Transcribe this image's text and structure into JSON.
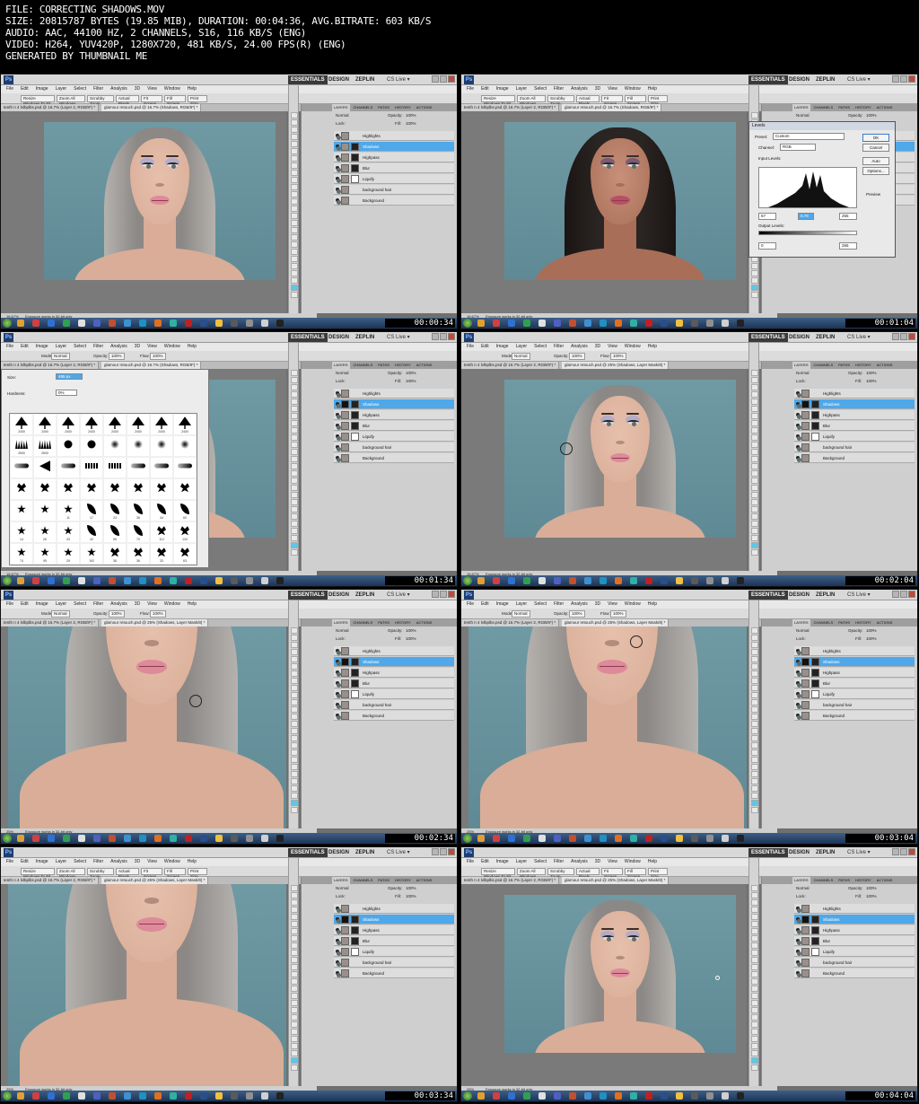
{
  "header": {
    "lines": [
      "FILE: CORRECTING SHADOWS.MOV",
      "SIZE: 20815787 BYTES (19.85 MIB), DURATION: 00:04:36, AVG.BITRATE: 603 KB/S",
      "AUDIO: AAC, 44100 HZ, 2 CHANNELS, S16, 116 KB/S (ENG)",
      "VIDEO: H264, YUV420P, 1280X720, 481 KB/S, 24.00 FPS(R) (ENG)",
      "GENERATED BY THUMBNAIL ME"
    ]
  },
  "ps": {
    "logo": "Ps",
    "workspaces": [
      "ESSENTIALS",
      "DESIGN",
      "ZEPLIN"
    ],
    "cs_live": "CS Live ▾",
    "menus": [
      "File",
      "Edit",
      "Image",
      "Layer",
      "Select",
      "Filter",
      "Analysis",
      "3D",
      "View",
      "Window",
      "Help"
    ],
    "zoom_options": [
      "Resize Windows To Fit",
      "Zoom All Windows",
      "Scrubby Zoom",
      "Actual Pixels",
      "Fit Screen",
      "Fill Screen",
      "Print Size"
    ],
    "brush_options": {
      "mode_label": "Mode:",
      "mode": "Normal",
      "opacity_label": "Opacity:",
      "opacity": "100%",
      "flow_label": "Flow:",
      "flow": "100%"
    },
    "doc_tabs": [
      "tenth n 4 lvlbplbs.psd @ 16.7% (Layer 2, RGB/8*) *",
      "glamour retouch.psd @ 16.7% (Shadows, RGB/8*) *"
    ],
    "doc_tabs_b": [
      "tenth n 4 lvlbplbs.psd @ 16.7% (Layer 2, RGB/8*) *",
      "glamour retouch.psd @ 25% (Shadows, Layer Mask/8) *"
    ],
    "panel_tabs": [
      "LAYERS",
      "CHANNELS",
      "PATHS",
      "HISTORY",
      "ACTIONS"
    ],
    "blend_mode": "Normal",
    "opacity_label": "Opacity:",
    "opacity": "100%",
    "lock_label": "Lock:",
    "fill_label": "Fill:",
    "fill": "100%",
    "layers": [
      "Highlights",
      "Shadows",
      "Highpass",
      "Blur",
      "Liquify",
      "background hair",
      "Background"
    ],
    "status": "Exposure works in 32-bit only",
    "zoom_a": "16.67%",
    "zoom_b": "25%"
  },
  "levels": {
    "title": "Levels",
    "preset_label": "Preset:",
    "preset": "Custom",
    "channel_label": "Channel:",
    "channel": "RGB",
    "input_label": "Input Levels:",
    "input_values": [
      "67",
      "0.78",
      "255"
    ],
    "output_label": "Output Levels:",
    "output_values": [
      "0",
      "255"
    ],
    "buttons": [
      "OK",
      "Cancel",
      "Auto",
      "Options..."
    ],
    "preview": "Preview"
  },
  "brush_picker": {
    "size_label": "Size:",
    "size": "485 px",
    "hardness_label": "Hardness:",
    "hardness": "0%",
    "numbers": [
      "2400",
      "2400",
      "2400",
      "2400",
      "2400",
      "2400",
      "2400",
      "2400",
      "2500",
      "2500",
      "",
      "",
      "",
      "",
      "",
      "",
      "",
      "",
      "",
      "",
      "",
      "",
      "",
      "",
      "",
      "",
      "",
      "",
      "",
      "",
      "",
      "",
      "",
      "",
      "11",
      "17",
      "23",
      "36",
      "44",
      "60",
      "14",
      "26",
      "33",
      "42",
      "55",
      "70",
      "112",
      "134",
      "74",
      "95",
      "29",
      "192",
      "36",
      "36",
      "33",
      "63",
      "66",
      "39"
    ]
  },
  "thumbs": [
    {
      "time": "00:00:34"
    },
    {
      "time": "00:01:04"
    },
    {
      "time": "00:01:34"
    },
    {
      "time": "00:02:04"
    },
    {
      "time": "00:02:34"
    },
    {
      "time": "00:03:04"
    },
    {
      "time": "00:03:34"
    },
    {
      "time": "00:04:04"
    }
  ],
  "colors": {
    "backdrop": "#6f9aa4",
    "selection": "#4ea8ea",
    "foreground_swatch": "#5bc8e8"
  }
}
